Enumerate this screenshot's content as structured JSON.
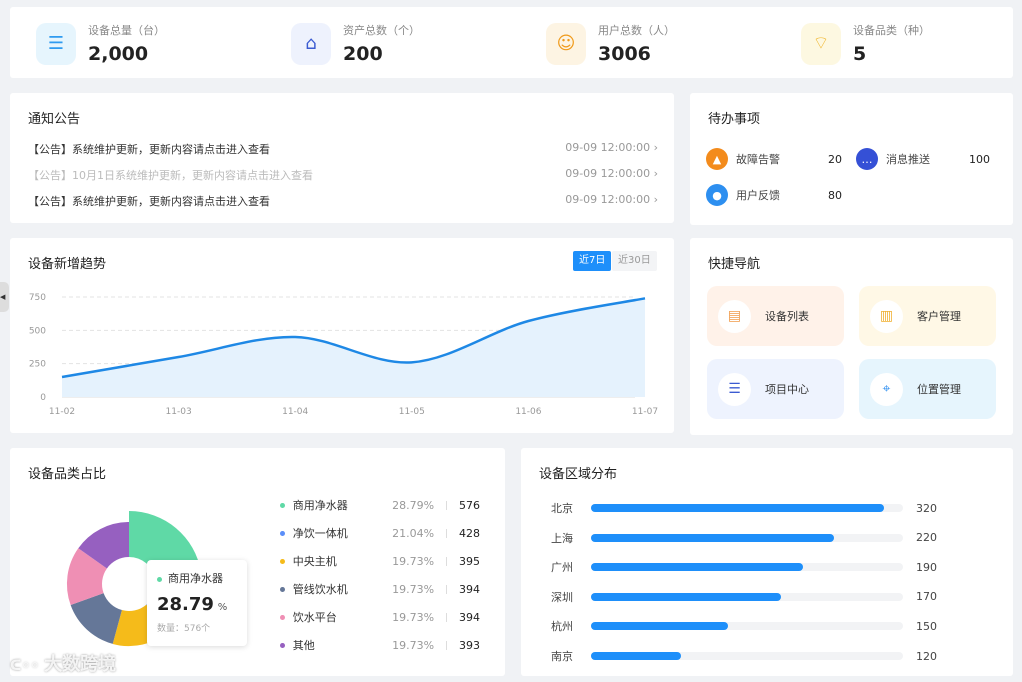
{
  "stats": [
    {
      "label": "设备总量（台）",
      "value": "2,000",
      "icon": "server-icon",
      "bg": "#e6f5fd",
      "color": "#2f9bf0"
    },
    {
      "label": "资产总数（个）",
      "value": "200",
      "icon": "home-icon",
      "bg": "#eef2fd",
      "color": "#3b5bd1"
    },
    {
      "label": "用户总数（人）",
      "value": "3006",
      "icon": "users-icon",
      "bg": "#fdf4e3",
      "color": "#f09a1a"
    },
    {
      "label": "设备品类（种）",
      "value": "5",
      "icon": "router-icon",
      "bg": "#fdf8e1",
      "color": "#f0b52a"
    }
  ],
  "notice": {
    "title": "通知公告",
    "items": [
      {
        "text": "【公告】系统维护更新，更新内容请点击进入查看",
        "time": "09-09 12:00:00",
        "read": false
      },
      {
        "text": "【公告】10月1日系统维护更新，更新内容请点击进入查看",
        "time": "09-09 12:00:00",
        "read": true
      },
      {
        "text": "【公告】系统维护更新，更新内容请点击进入查看",
        "time": "09-09 12:00:00",
        "read": false
      }
    ]
  },
  "todo": {
    "title": "待办事项",
    "items": [
      {
        "label": "故障告警",
        "count": "20",
        "icon": "alarm-icon",
        "color": "#f38b1c"
      },
      {
        "label": "消息推送",
        "count": "100",
        "icon": "message-icon",
        "color": "#3550d6"
      },
      {
        "label": "用户反馈",
        "count": "80",
        "icon": "user-icon",
        "color": "#2d8ff0"
      }
    ]
  },
  "trend": {
    "title": "设备新增趋势",
    "tabs": [
      "近7日",
      "近30日"
    ],
    "active_tab": 0
  },
  "chart_data": [
    {
      "type": "area",
      "x": [
        "11-02",
        "11-03",
        "11-04",
        "11-05",
        "11-06",
        "11-07"
      ],
      "values": [
        150,
        300,
        450,
        260,
        570,
        740
      ],
      "yticks": [
        "0",
        "250",
        "500",
        "750"
      ],
      "ylim": [
        0,
        750
      ],
      "grid": true,
      "color": "#1e88e5"
    },
    {
      "type": "pie",
      "title": "设备品类占比",
      "categories": [
        "商用净水器",
        "净饮一体机",
        "中央主机",
        "管线饮水机",
        "饮水平台",
        "其他"
      ],
      "percents": [
        "28.79%",
        "21.04%",
        "19.73%",
        "19.73%",
        "19.73%",
        "19.73%"
      ],
      "values": [
        576,
        428,
        395,
        394,
        394,
        393
      ],
      "colors": [
        "#5fd9a6",
        "#5b8ff9",
        "#f5bb1a",
        "#657798",
        "#ef8fb4",
        "#9660c0"
      ],
      "tooltip": {
        "name": "商用净水器",
        "value": "28.79",
        "unit": "%",
        "count": "数量：576个"
      }
    },
    {
      "type": "bar",
      "title": "设备区域分布",
      "categories": [
        "北京",
        "上海",
        "广州",
        "深圳",
        "杭州",
        "南京"
      ],
      "values": [
        320,
        220,
        190,
        170,
        150,
        120
      ],
      "fill_fractions": [
        0.94,
        0.78,
        0.68,
        0.61,
        0.44,
        0.29
      ]
    }
  ],
  "quicknav": {
    "title": "快捷导航",
    "items": [
      {
        "label": "设备列表",
        "icon": "device-list-icon",
        "bg": "#fff2e9",
        "color": "#f09a4a"
      },
      {
        "label": "客户管理",
        "icon": "customer-icon",
        "bg": "#fff8e6",
        "color": "#f0b030"
      },
      {
        "label": "项目中心",
        "icon": "project-icon",
        "bg": "#eef3fe",
        "color": "#3b5bd1"
      },
      {
        "label": "位置管理",
        "icon": "location-icon",
        "bg": "#e6f5fd",
        "color": "#2f8ff0"
      }
    ]
  },
  "watermark": "大数跨境"
}
